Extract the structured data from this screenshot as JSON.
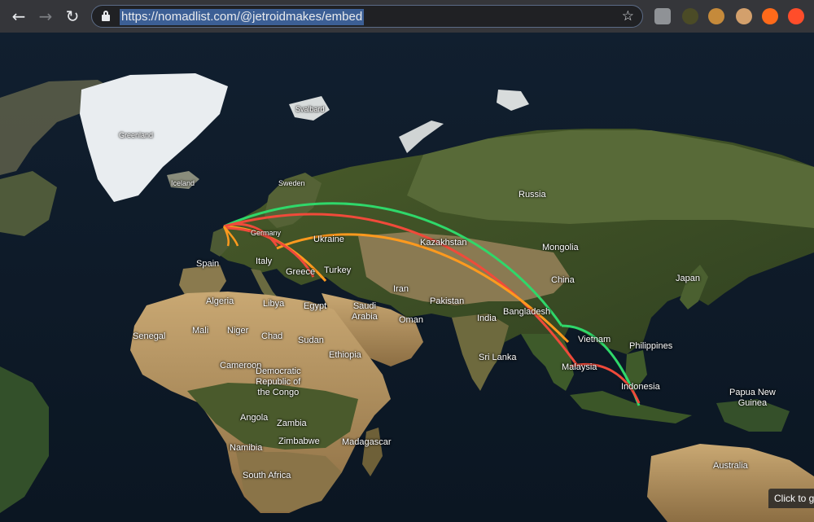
{
  "browser": {
    "url": "https://nomadlist.com/@jetroidmakes/embed",
    "back_icon": "←",
    "forward_icon": "→",
    "reload_icon": "↻",
    "star_icon": "☆",
    "extensions": [
      {
        "name": "ublock-origin",
        "color": "#8f9296"
      },
      {
        "name": "highlighter",
        "color": "#6b6b2e"
      },
      {
        "name": "cookie",
        "color": "#c58a3b"
      },
      {
        "name": "face",
        "color": "#d3a06c"
      },
      {
        "name": "play-orange",
        "color": "#ff6a1a"
      },
      {
        "name": "play-orange-2",
        "color": "#ff4d2a"
      }
    ]
  },
  "map": {
    "labels": {
      "greenland": "Greenland",
      "svalbard": "Svalbard",
      "iceland": "Iceland",
      "sweden": "Sweden",
      "russia": "Russia",
      "germany": "Germany",
      "ukraine": "Ukraine",
      "kazakhstan": "Kazakhstan",
      "mongolia": "Mongolia",
      "spain": "Spain",
      "italy": "Italy",
      "greece": "Greece",
      "turkey": "Turkey",
      "china": "China",
      "japan": "Japan",
      "iran": "Iran",
      "algeria": "Algeria",
      "libya": "Libya",
      "egypt": "Egypt",
      "saudi_arabia": "Saudi\nArabia",
      "pakistan": "Pakistan",
      "india": "India",
      "bangladesh": "Bangladesh",
      "oman": "Oman",
      "senegal": "Senegal",
      "mali": "Mali",
      "niger": "Niger",
      "chad": "Chad",
      "sudan": "Sudan",
      "vietnam": "Vietnam",
      "philippines": "Philippines",
      "ethiopia": "Ethiopia",
      "sri_lanka": "Sri Lanka",
      "cameroon": "Cameroon",
      "drc": "Democratic\nRepublic of\nthe Congo",
      "malaysia": "Malaysia",
      "indonesia": "Indonesia",
      "papua_new_guinea": "Papua New\nGuinea",
      "angola": "Angola",
      "zambia": "Zambia",
      "zimbabwe": "Zimbabwe",
      "namibia": "Namibia",
      "madagascar": "Madagascar",
      "south_africa": "South Africa",
      "australia": "Australia"
    },
    "route_colors": {
      "green": "#2fd86a",
      "red": "#f04a3a",
      "orange": "#ff9a1e"
    },
    "click_tip": "Click to g"
  }
}
